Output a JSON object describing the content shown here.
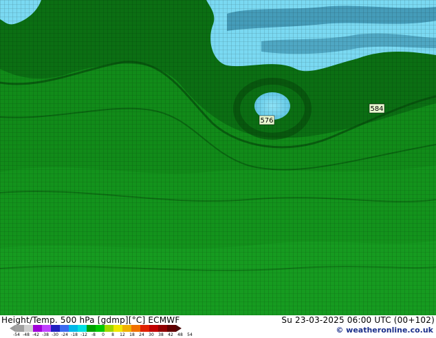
{
  "map": {
    "contour_labels": [
      "576",
      "584"
    ],
    "colors": {
      "land_green_dark": "#0a6e12",
      "land_green": "#118b19",
      "land_green_light": "#1aa323",
      "cold_cyan": "#7ad9f2",
      "grid_black": "#000000"
    }
  },
  "footer": {
    "title": "Height/Temp. 500 hPa [gdmp][°C] ECMWF",
    "datetime": "Su 23-03-2025 06:00 UTC (00+102)",
    "credit": "© weatheronline.co.uk"
  },
  "legend": {
    "ticks": [
      "-54",
      "-48",
      "-42",
      "-38",
      "-30",
      "-24",
      "-18",
      "-12",
      "-8",
      "0",
      "8",
      "12",
      "18",
      "24",
      "30",
      "38",
      "42",
      "48",
      "54"
    ],
    "colors": [
      "#a0a0a0",
      "#d0d0d0",
      "#a000d8",
      "#c040ff",
      "#2020c0",
      "#3a6af0",
      "#00b8e8",
      "#00e0e0",
      "#00a000",
      "#00c800",
      "#a0d800",
      "#f0e800",
      "#f0b000",
      "#f07000",
      "#e02000",
      "#c00000",
      "#900000",
      "#600000"
    ]
  }
}
